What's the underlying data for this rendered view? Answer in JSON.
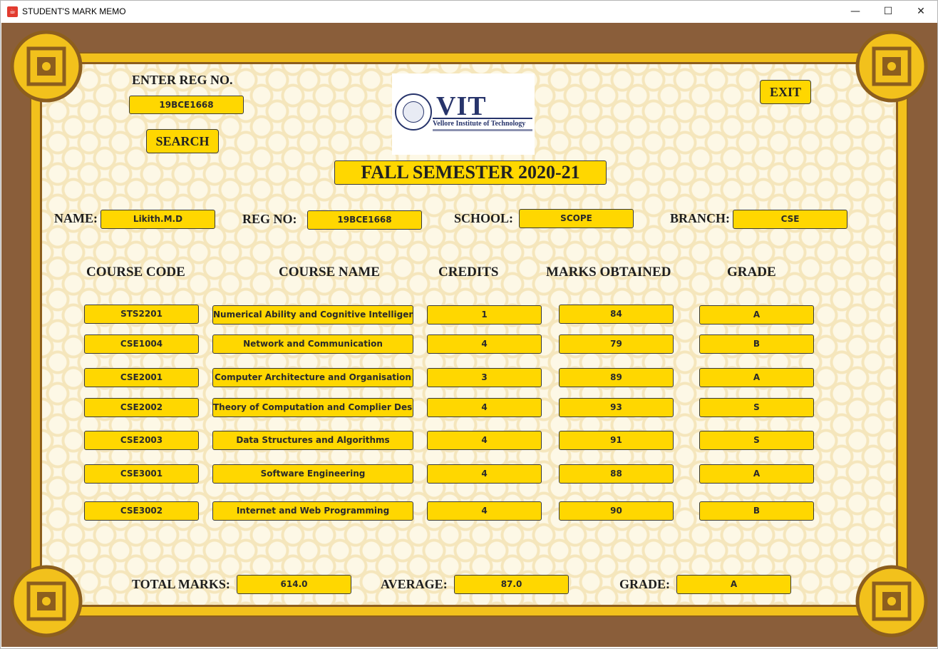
{
  "window": {
    "title": "STUDENT'S MARK MEMO",
    "icon": "java-cup-icon",
    "controls": {
      "minimize": "—",
      "maximize": "☐",
      "close": "✕"
    }
  },
  "colors": {
    "background": "#8a5e3a",
    "frame": "#f2c11c",
    "field": "#ffd700",
    "logo_text": "#27346b"
  },
  "search": {
    "label": "ENTER REG NO.",
    "value": "19BCE1668",
    "button": "SEARCH"
  },
  "exit_button": "EXIT",
  "logo": {
    "name": "VIT",
    "subtitle": "Vellore Institute of Technology"
  },
  "semester_title": "FALL SEMESTER 2020-21",
  "student": {
    "name_label": "NAME:",
    "name": "Likith.M.D",
    "regno_label": "REG NO:",
    "regno": "19BCE1668",
    "school_label": "SCHOOL:",
    "school": "SCOPE",
    "branch_label": "BRANCH:",
    "branch": "CSE"
  },
  "table": {
    "headers": [
      "COURSE CODE",
      "COURSE NAME",
      "CREDITS",
      "MARKS OBTAINED",
      "GRADE"
    ],
    "rows": [
      {
        "code": "STS2201",
        "name": "Numerical Ability and Cognitive Intelligence",
        "credits": "1",
        "marks": "84",
        "grade": "A"
      },
      {
        "code": "CSE1004",
        "name": "Network and Communication",
        "credits": "4",
        "marks": "79",
        "grade": "B"
      },
      {
        "code": "CSE2001",
        "name": "Computer Architecture and Organisation",
        "credits": "3",
        "marks": "89",
        "grade": "A"
      },
      {
        "code": "CSE2002",
        "name": "Theory of Computation and Complier Design",
        "credits": "4",
        "marks": "93",
        "grade": "S"
      },
      {
        "code": "CSE2003",
        "name": "Data Structures and Algorithms",
        "credits": "4",
        "marks": "91",
        "grade": "S"
      },
      {
        "code": "CSE3001",
        "name": "Software Engineering",
        "credits": "4",
        "marks": "88",
        "grade": "A"
      },
      {
        "code": "CSE3002",
        "name": "Internet and Web Programming",
        "credits": "4",
        "marks": "90",
        "grade": "B"
      }
    ]
  },
  "summary": {
    "total_label": "TOTAL MARKS:",
    "total": "614.0",
    "average_label": "AVERAGE:",
    "average": "87.0",
    "grade_label": "GRADE:",
    "grade": "A"
  }
}
